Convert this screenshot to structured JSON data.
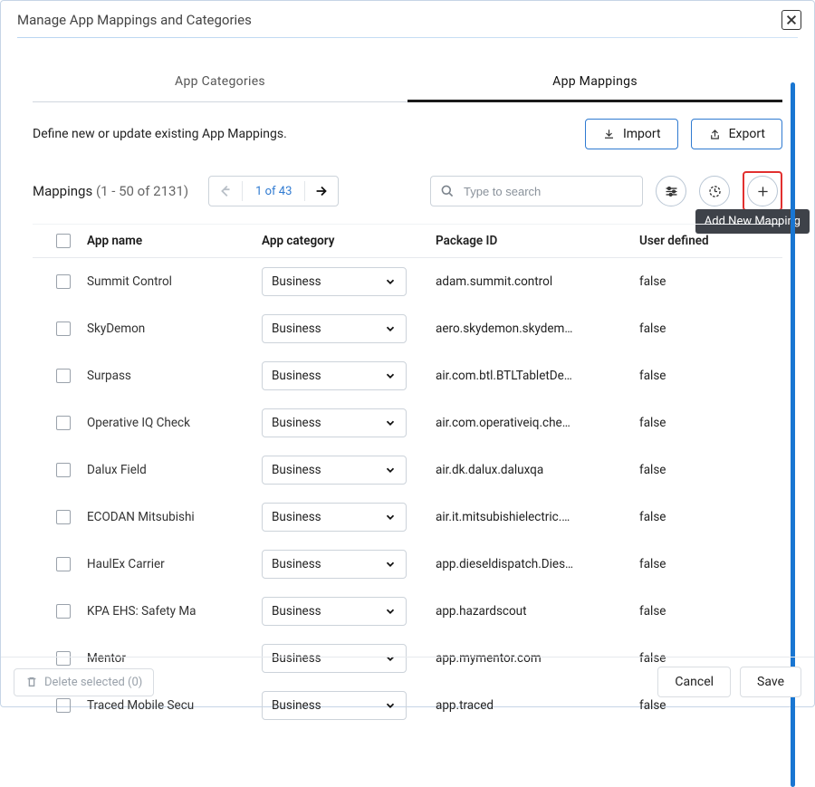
{
  "dialog": {
    "title": "Manage App Mappings and Categories",
    "close_icon": "close"
  },
  "tabs": {
    "categories_label": "App Categories",
    "mappings_label": "App Mappings"
  },
  "toolbar1": {
    "description": "Define new or update existing App Mappings.",
    "import_label": "Import",
    "export_label": "Export"
  },
  "toolbar2": {
    "mappings_title": "Mappings",
    "range_label": "(1 - 50 of 2131)",
    "page_label": "1 of 43",
    "search_placeholder": "Type to search",
    "filter_icon": "filter-settings",
    "reset_icon": "reset",
    "add_icon": "plus",
    "add_tooltip": "Add New Mapping"
  },
  "table": {
    "headers": {
      "name": "App name",
      "category": "App category",
      "package": "Package ID",
      "user_defined": "User defined"
    },
    "category_value": "Business",
    "rows": [
      {
        "name": "Summit Control",
        "package": "adam.summit.control",
        "user_defined": "false"
      },
      {
        "name": "SkyDemon",
        "package": "aero.skydemon.skydem…",
        "user_defined": "false"
      },
      {
        "name": "Surpass",
        "package": "air.com.btl.BTLTabletDe…",
        "user_defined": "false"
      },
      {
        "name": "Operative IQ Check",
        "package": "air.com.operativeiq.che…",
        "user_defined": "false"
      },
      {
        "name": "Dalux Field",
        "package": "air.dk.dalux.daluxqa",
        "user_defined": "false"
      },
      {
        "name": "ECODAN Mitsubishi",
        "package": "air.it.mitsubishielectric.…",
        "user_defined": "false"
      },
      {
        "name": "HaulEx Carrier",
        "package": "app.dieseldispatch.Dies…",
        "user_defined": "false"
      },
      {
        "name": "KPA EHS: Safety Ma",
        "package": "app.hazardscout",
        "user_defined": "false"
      },
      {
        "name": "Mentor",
        "package": "app.mymentor.com",
        "user_defined": "false"
      },
      {
        "name": "Traced Mobile Secu",
        "package": "app.traced",
        "user_defined": "false"
      }
    ]
  },
  "footer": {
    "delete_label": "Delete selected (0)",
    "cancel_label": "Cancel",
    "save_label": "Save"
  }
}
